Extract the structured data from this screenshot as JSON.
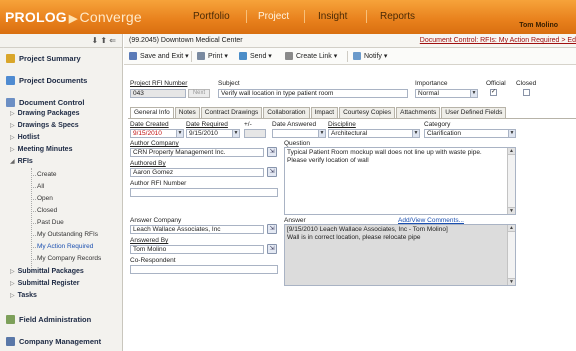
{
  "app": {
    "logo_main": "PROLOG",
    "logo_sub": "Converge",
    "user": "Tom Molino"
  },
  "nav": [
    {
      "label": "Portfolio",
      "active": false
    },
    {
      "label": "Project",
      "active": true
    },
    {
      "label": "Insight",
      "active": false
    },
    {
      "label": "Reports",
      "active": false
    }
  ],
  "sidebar": {
    "sections": [
      {
        "label": "Project Summary",
        "icon": "star-icon"
      },
      {
        "label": "Project Documents",
        "icon": "folder-icon"
      },
      {
        "label": "Document Control",
        "icon": "document-control-icon"
      },
      {
        "label": "Field Administration",
        "icon": "field-admin-icon"
      },
      {
        "label": "Company Management",
        "icon": "company-icon"
      }
    ],
    "items": [
      {
        "label": "Drawing Packages",
        "toggle": "▷"
      },
      {
        "label": "Drawings & Specs",
        "toggle": "▷"
      },
      {
        "label": "Hotlist",
        "toggle": "▷"
      },
      {
        "label": "Meeting Minutes",
        "toggle": "▷"
      },
      {
        "label": "RFIs",
        "toggle": "◢"
      },
      {
        "label": "Submittal Packages",
        "toggle": "▷"
      },
      {
        "label": "Submittal Register",
        "toggle": "▷"
      },
      {
        "label": "Tasks",
        "toggle": "▷"
      }
    ],
    "rfi_sub": [
      "Create",
      "All",
      "Open",
      "Closed",
      "Past Due",
      "My Outstanding RFIs",
      "My Action Required",
      "My Company Records"
    ]
  },
  "crumb": {
    "nav": "⬇ ⬆ ⇐",
    "title": "(99.2045) Downtown Medical Center",
    "link": "Document Control: RFIs: My Action Required > Ed"
  },
  "toolbar": {
    "save_exit": "Save and Exit ▾",
    "print": "Print ▾",
    "send": "Send ▾",
    "create_link": "Create Link ▾",
    "notify": "Notify ▾"
  },
  "header": {
    "rfi_number_label": "Project RFI Number",
    "rfi_number": "043",
    "next_label": "Next",
    "subject_label": "Subject",
    "subject": "Verify wall location in type patient room",
    "importance_label": "Importance",
    "importance": "Normal",
    "official_label": "Official",
    "closed_label": "Closed",
    "official_mark": "✓",
    "closed_mark": ""
  },
  "tabs": [
    "General Info",
    "Notes",
    "Contract Drawings",
    "Collaboration",
    "Impact",
    "Courtesy Copies",
    "Attachments",
    "User Defined Fields"
  ],
  "form": {
    "date_created_label": "Date Created",
    "date_created": "9/15/2010",
    "date_required_label": "Date Required",
    "date_required": "9/15/2010",
    "plusminus_label": "+/-",
    "date_answered_label": "Date Answered",
    "discipline_label": "Discipline",
    "discipline": "Architectural",
    "category_label": "Category",
    "category": "Clarification",
    "author_company_label": "Author Company",
    "author_company": "CRN Property Management Inc.",
    "authored_by_label": "Authored By",
    "authored_by": "Aaron Gomez",
    "author_rfi_label": "Author RFI Number",
    "question_label": "Question",
    "question_lines": [
      "Typical Patient Room mockup wall does not line up with waste pipe.",
      "Please verify location of wall"
    ],
    "answer_company_label": "Answer Company",
    "answer_company": "Leach Wallace Associates, Inc",
    "answered_by_label": "Answered By",
    "answered_by": "Tom Molino",
    "corespondent_label": "Co-Respondent",
    "answer_label": "Answer",
    "add_comments": "Add/View Comments...",
    "answer_lines": [
      "[9/15/2010 Leach Wallace Associates, Inc - Tom Molino]",
      "Wall is in correct location, please relocate pipe"
    ]
  },
  "colors": {
    "brand_orange": "#e8801c",
    "link_blue": "#1a4fb0",
    "crumb_red": "#a01010"
  }
}
